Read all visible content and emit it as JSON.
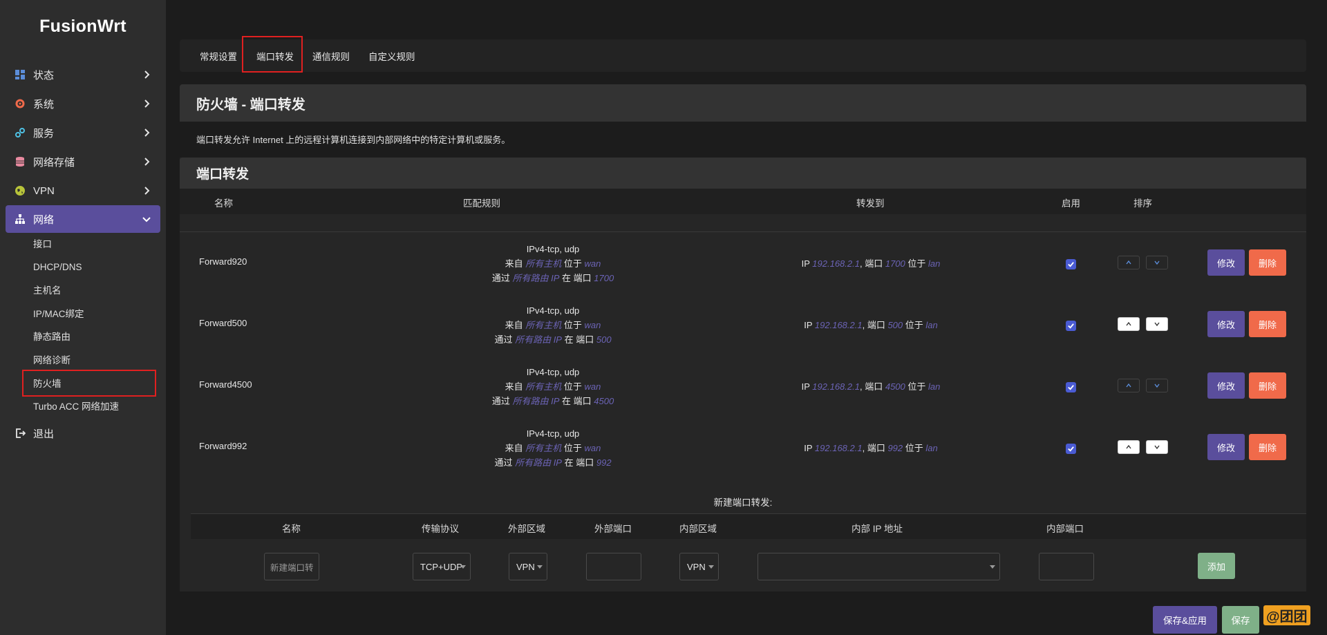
{
  "brand": "FusionWrt",
  "sidebar": {
    "items": [
      {
        "label": "状态",
        "icon": "dashboard-icon"
      },
      {
        "label": "系统",
        "icon": "gear-icon"
      },
      {
        "label": "服务",
        "icon": "services-icon"
      },
      {
        "label": "网络存储",
        "icon": "database-icon"
      },
      {
        "label": "VPN",
        "icon": "globe-icon"
      },
      {
        "label": "网络",
        "icon": "network-icon"
      }
    ],
    "sub_items": [
      "接口",
      "DHCP/DNS",
      "主机名",
      "IP/MAC绑定",
      "静态路由",
      "网络诊断",
      "防火墙",
      "Turbo ACC 网络加速"
    ],
    "logout": "退出"
  },
  "tabs": [
    "常规设置",
    "端口转发",
    "通信规则",
    "自定义规则"
  ],
  "page_title": "防火墙 - 端口转发",
  "description": "端口转发允许 Internet 上的远程计算机连接到内部网络中的特定计算机或服务。",
  "section_title": "端口转发",
  "table": {
    "headers": [
      "名称",
      "匹配规则",
      "转发到",
      "启用",
      "排序"
    ],
    "rows": [
      {
        "name": "Forward920",
        "proto": "IPv4-tcp, udp",
        "from_pre": "来自",
        "from_val": "所有主机",
        "from_mid": "位于",
        "from_zone": "wan",
        "via_pre": "通过",
        "via_val": "所有路由 IP",
        "via_mid": "在 端口",
        "via_port": "1700",
        "ip_pre": "IP",
        "ip_val": "192.168.2.1",
        "port_pre": ", 端口",
        "port_val": "1700",
        "zone_pre": "位于",
        "zone_val": "lan",
        "edit": "修改",
        "del": "删除"
      },
      {
        "name": "Forward500",
        "proto": "IPv4-tcp, udp",
        "from_pre": "来自",
        "from_val": "所有主机",
        "from_mid": "位于",
        "from_zone": "wan",
        "via_pre": "通过",
        "via_val": "所有路由 IP",
        "via_mid": "在 端口",
        "via_port": "500",
        "ip_pre": "IP",
        "ip_val": "192.168.2.1",
        "port_pre": ", 端口",
        "port_val": "500",
        "zone_pre": "位于",
        "zone_val": "lan",
        "edit": "修改",
        "del": "删除"
      },
      {
        "name": "Forward4500",
        "proto": "IPv4-tcp, udp",
        "from_pre": "来自",
        "from_val": "所有主机",
        "from_mid": "位于",
        "from_zone": "wan",
        "via_pre": "通过",
        "via_val": "所有路由 IP",
        "via_mid": "在 端口",
        "via_port": "4500",
        "ip_pre": "IP",
        "ip_val": "192.168.2.1",
        "port_pre": ", 端口",
        "port_val": "4500",
        "zone_pre": "位于",
        "zone_val": "lan",
        "edit": "修改",
        "del": "删除"
      },
      {
        "name": "Forward992",
        "proto": "IPv4-tcp, udp",
        "from_pre": "来自",
        "from_val": "所有主机",
        "from_mid": "位于",
        "from_zone": "wan",
        "via_pre": "通过",
        "via_val": "所有路由 IP",
        "via_mid": "在 端口",
        "via_port": "992",
        "ip_pre": "IP",
        "ip_val": "192.168.2.1",
        "port_pre": ", 端口",
        "port_val": "992",
        "zone_pre": "位于",
        "zone_val": "lan",
        "edit": "修改",
        "del": "删除"
      }
    ]
  },
  "new_forward": {
    "title": "新建端口转发:",
    "headers": [
      "名称",
      "传输协议",
      "外部区域",
      "外部端口",
      "内部区域",
      "内部 IP 地址",
      "内部端口"
    ],
    "name_placeholder": "新建端口转",
    "protocol": "TCP+UDP",
    "ext_zone": "VPN",
    "int_zone": "VPN",
    "add": "添加"
  },
  "footer": {
    "save_apply": "保存&应用",
    "save": "保存"
  },
  "watermark": "@团团",
  "colors": {
    "accent": "#5a4e9c",
    "danger": "#f06a4a",
    "success": "#7fb088",
    "highlight": "#e02020"
  }
}
